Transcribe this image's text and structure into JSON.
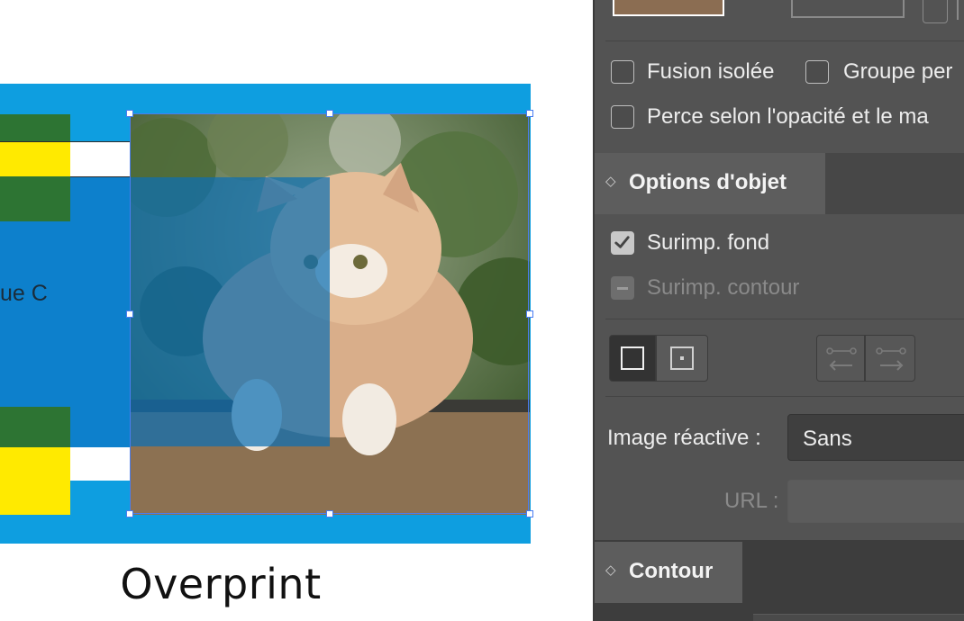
{
  "canvas": {
    "partial_label": "ue C",
    "caption": "Overprint"
  },
  "panel": {
    "transparency": {
      "fusion_isolee": "Fusion isolée",
      "groupe_perce": "Groupe per",
      "perce_opacite": "Perce selon l'opacité et le ma"
    },
    "options_objet": {
      "title": "Options d'objet",
      "surimp_fond": "Surimp. fond",
      "surimp_fond_checked": true,
      "surimp_contour": "Surimp. contour",
      "surimp_contour_enabled": false,
      "image_reactive_label": "Image réactive :",
      "image_reactive_value": "Sans",
      "url_label": "URL :",
      "url_value": ""
    },
    "contour": {
      "title": "Contour"
    }
  },
  "colors": {
    "cyan": "#0e9ee0",
    "blue": "#0d80cc",
    "green": "#2d7433",
    "yellow": "#ffea00",
    "selection": "#4a7df0",
    "panel_bg": "#535353"
  }
}
